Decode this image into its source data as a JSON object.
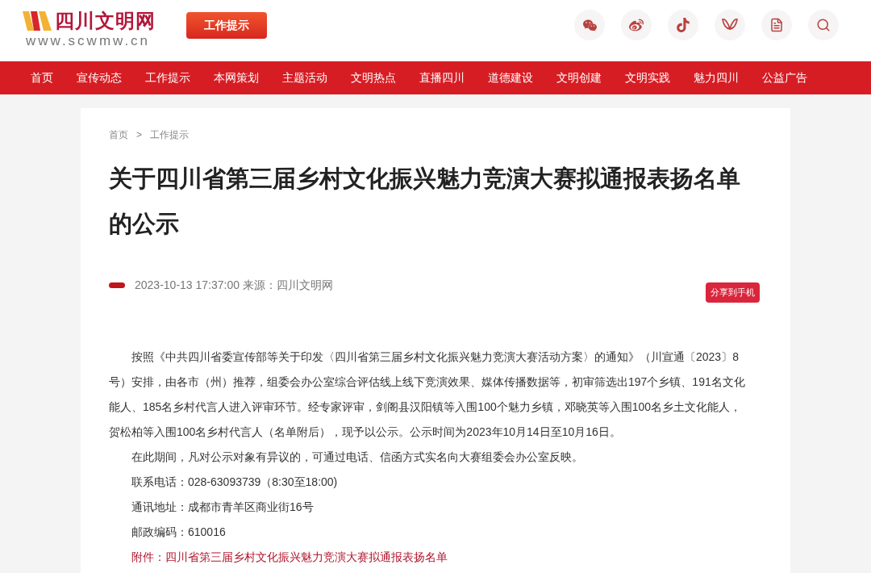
{
  "header": {
    "site_name": "四川文明网",
    "site_url": "www.scwmw.cn",
    "badge": "工作提示"
  },
  "nav": [
    {
      "label": "首页"
    },
    {
      "label": "宣传动态"
    },
    {
      "label": "工作提示"
    },
    {
      "label": "本网策划"
    },
    {
      "label": "主题活动"
    },
    {
      "label": "文明热点"
    },
    {
      "label": "直播四川"
    },
    {
      "label": "道德建设"
    },
    {
      "label": "文明创建"
    },
    {
      "label": "文明实践"
    },
    {
      "label": "魅力四川"
    },
    {
      "label": "公益广告"
    }
  ],
  "breadcrumb": [
    "首页",
    ">",
    "工作提示"
  ],
  "article": {
    "title": "关于四川省第三届乡村文化振兴魅力竞演大赛拟通报表扬名单的公示",
    "meta": "2023-10-13 17:37:00 来源：四川文明网",
    "share_button": "分享到手机",
    "paragraphs": [
      {
        "kind": "indent",
        "text": "按照《中共四川省委宣传部等关于印发〈四川省第三届乡村文化振兴魅力竞演大赛活动方案〉的通知》（川宣通〔2023〕8号）安排，由各市（州）推荐，组委会办公室综合评估线上线下竞演效果、媒体传播数据等，初审筛选出197个乡镇、191名文化能人、185名乡村代言人进入评审环节。经专家评审，剑阁县汉阳镇等入围100个魅力乡镇，邓晓英等入围100名乡土文化能人，贺松柏等入围100名乡村代言人（名单附后），现予以公示。公示时间为2023年10月14日至10月16日。"
      },
      {
        "kind": "line",
        "text": "在此期间，凡对公示对象有异议的，可通过电话、信函方式实名向大赛组委会办公室反映。"
      },
      {
        "kind": "line",
        "text": "联系电话：028-63093739（8:30至18:00)"
      },
      {
        "kind": "line",
        "text": "通讯地址：成都市青羊区商业街16号"
      },
      {
        "kind": "line",
        "text": "邮政编码：610016"
      },
      {
        "kind": "link",
        "text": "附件：四川省第三届乡村文化振兴魅力竞演大赛拟通报表扬名单"
      }
    ]
  }
}
